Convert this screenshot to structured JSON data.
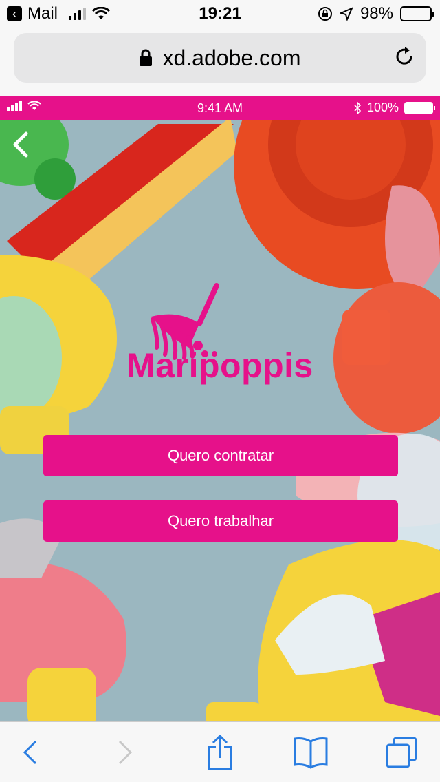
{
  "ios_status": {
    "back_app": "Mail",
    "time": "19:21",
    "battery": "98%",
    "battery_level": 0.98
  },
  "browser": {
    "url": "xd.adobe.com"
  },
  "prototype": {
    "status": {
      "time": "9:41 AM",
      "battery": "100%"
    },
    "brand_name": "Maripoppis",
    "buttons": {
      "hire": "Quero contratar",
      "work": "Quero trabalhar"
    },
    "colors": {
      "accent": "#e6118a",
      "background": "#9bb7c0"
    }
  },
  "icons": {
    "back": "chevron-left-icon",
    "forward": "chevron-right-icon",
    "share": "share-icon",
    "bookmarks": "book-icon",
    "tabs": "tabs-icon",
    "lock": "lock-icon",
    "reload": "reload-icon",
    "logo": "broom-icon"
  }
}
